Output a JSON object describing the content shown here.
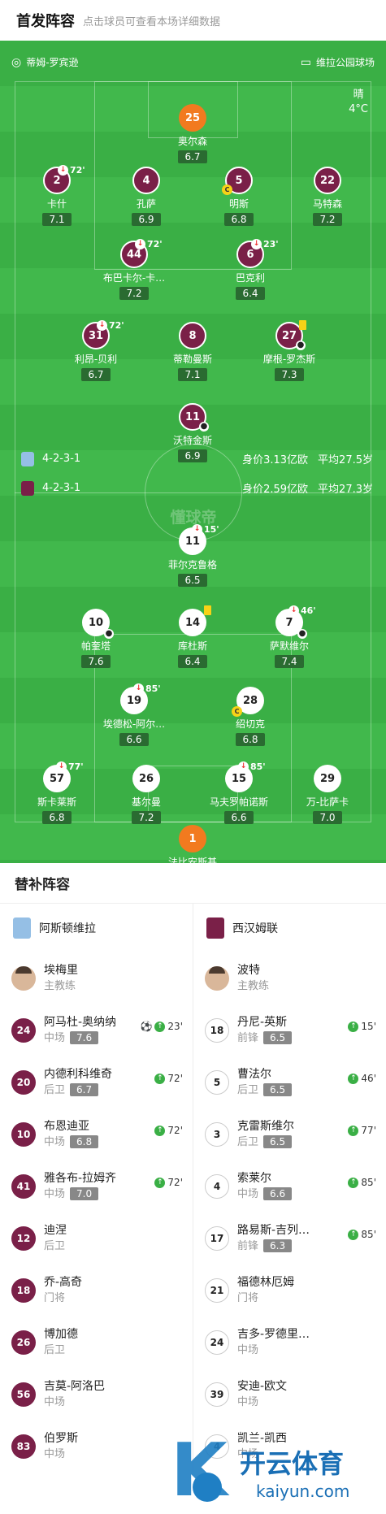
{
  "header": {
    "title": "首发阵容",
    "subtitle": "点击球员可查看本场详细数据"
  },
  "pitch": {
    "referee": "蒂姆-罗宾逊",
    "stadium": "维拉公园球场",
    "weather": "晴",
    "temperature": "4°C",
    "watermark": "懂球帝",
    "home": {
      "formation": "4-2-3-1",
      "value": "身价3.13亿欧",
      "avg_age": "平均27.5岁"
    },
    "away": {
      "formation": "4-2-3-1",
      "value": "身价2.59亿欧",
      "avg_age": "平均27.3岁"
    },
    "players": [
      {
        "num": "25",
        "name": "奥尔森",
        "rating": "6.7",
        "kit": "orange"
      },
      {
        "num": "2",
        "name": "卡什",
        "rating": "7.1",
        "kit": "claret",
        "sub": "72'"
      },
      {
        "num": "4",
        "name": "孔萨",
        "rating": "6.9",
        "kit": "claret"
      },
      {
        "num": "5",
        "name": "明斯",
        "rating": "6.8",
        "kit": "claret",
        "captain": "C"
      },
      {
        "num": "22",
        "name": "马特森",
        "rating": "7.2",
        "kit": "claret"
      },
      {
        "num": "44",
        "name": "布巴卡尔-卡…",
        "rating": "7.2",
        "kit": "claret",
        "sub": "72'"
      },
      {
        "num": "6",
        "name": "巴克利",
        "rating": "6.4",
        "kit": "claret",
        "sub": "23'"
      },
      {
        "num": "31",
        "name": "利昂-贝利",
        "rating": "6.7",
        "kit": "claret",
        "sub": "72'"
      },
      {
        "num": "8",
        "name": "蒂勒曼斯",
        "rating": "7.1",
        "kit": "claret"
      },
      {
        "num": "27",
        "name": "摩根-罗杰斯",
        "rating": "7.3",
        "kit": "claret",
        "yellow": true,
        "goal": true
      },
      {
        "num": "11",
        "name": "沃特金斯",
        "rating": "6.9",
        "kit": "claret",
        "goal": true
      },
      {
        "num": "11",
        "name": "菲尔克鲁格",
        "rating": "6.5",
        "kit": "white",
        "sub": "15'"
      },
      {
        "num": "10",
        "name": "帕奎塔",
        "rating": "7.6",
        "kit": "white",
        "goal": true
      },
      {
        "num": "14",
        "name": "库杜斯",
        "rating": "6.4",
        "kit": "white",
        "yellow": true
      },
      {
        "num": "7",
        "name": "萨默维尔",
        "rating": "7.4",
        "kit": "white",
        "sub": "46'",
        "goal": true
      },
      {
        "num": "19",
        "name": "埃德松-阿尔…",
        "rating": "6.6",
        "kit": "white",
        "sub": "85'"
      },
      {
        "num": "28",
        "name": "绍切克",
        "rating": "6.8",
        "kit": "white",
        "captain": "C"
      },
      {
        "num": "57",
        "name": "斯卡莱斯",
        "rating": "6.8",
        "kit": "white",
        "sub": "77'"
      },
      {
        "num": "26",
        "name": "基尔曼",
        "rating": "7.2",
        "kit": "white"
      },
      {
        "num": "15",
        "name": "马夫罗帕诺斯",
        "rating": "6.6",
        "kit": "white",
        "sub": "85'"
      },
      {
        "num": "29",
        "name": "万-比萨卡",
        "rating": "7.0",
        "kit": "white"
      },
      {
        "num": "1",
        "name": "法比安斯基",
        "rating": "6.9",
        "kit": "orange"
      }
    ]
  },
  "subs": {
    "title": "替补阵容",
    "home": {
      "team": "阿斯顿维拉",
      "coach": "埃梅里",
      "coach_role": "主教练",
      "colors": {
        "kit": "#7a2048"
      },
      "players": [
        {
          "num": "24",
          "name": "阿马杜-奥纳纳",
          "pos": "中场",
          "rating": "7.6",
          "event": "23'",
          "goal": true
        },
        {
          "num": "20",
          "name": "内德利科维奇",
          "pos": "后卫",
          "rating": "6.7",
          "event": "72'"
        },
        {
          "num": "10",
          "name": "布恩迪亚",
          "pos": "中场",
          "rating": "6.8",
          "event": "72'"
        },
        {
          "num": "41",
          "name": "雅各布-拉姆齐",
          "pos": "中场",
          "rating": "7.0",
          "event": "72'"
        },
        {
          "num": "12",
          "name": "迪涅",
          "pos": "后卫"
        },
        {
          "num": "18",
          "name": "乔-高奇",
          "pos": "门将"
        },
        {
          "num": "26",
          "name": "博加德",
          "pos": "后卫"
        },
        {
          "num": "56",
          "name": "吉莫-阿洛巴",
          "pos": "中场"
        },
        {
          "num": "83",
          "name": "伯罗斯",
          "pos": "中场"
        }
      ]
    },
    "away": {
      "team": "西汉姆联",
      "coach": "波特",
      "coach_role": "主教练",
      "colors": {
        "kit": "#ffffff"
      },
      "players": [
        {
          "num": "18",
          "name": "丹尼-英斯",
          "pos": "前锋",
          "rating": "6.5",
          "event": "15'"
        },
        {
          "num": "5",
          "name": "曹法尔",
          "pos": "后卫",
          "rating": "6.5",
          "event": "46'"
        },
        {
          "num": "3",
          "name": "克雷斯维尔",
          "pos": "后卫",
          "rating": "6.5",
          "event": "77'"
        },
        {
          "num": "4",
          "name": "索莱尔",
          "pos": "中场",
          "rating": "6.6",
          "event": "85'"
        },
        {
          "num": "17",
          "name": "路易斯-吉列…",
          "pos": "前锋",
          "rating": "6.3",
          "event": "85'"
        },
        {
          "num": "21",
          "name": "福德林厄姆",
          "pos": "门将"
        },
        {
          "num": "24",
          "name": "吉多-罗德里…",
          "pos": "中场"
        },
        {
          "num": "39",
          "name": "安迪-欧文",
          "pos": "中场"
        },
        {
          "num": "4",
          "name": "凯兰-凯西",
          "pos": "中场"
        }
      ]
    }
  },
  "watermark": {
    "brand": "开云体育",
    "url": "kaiyun.com"
  }
}
